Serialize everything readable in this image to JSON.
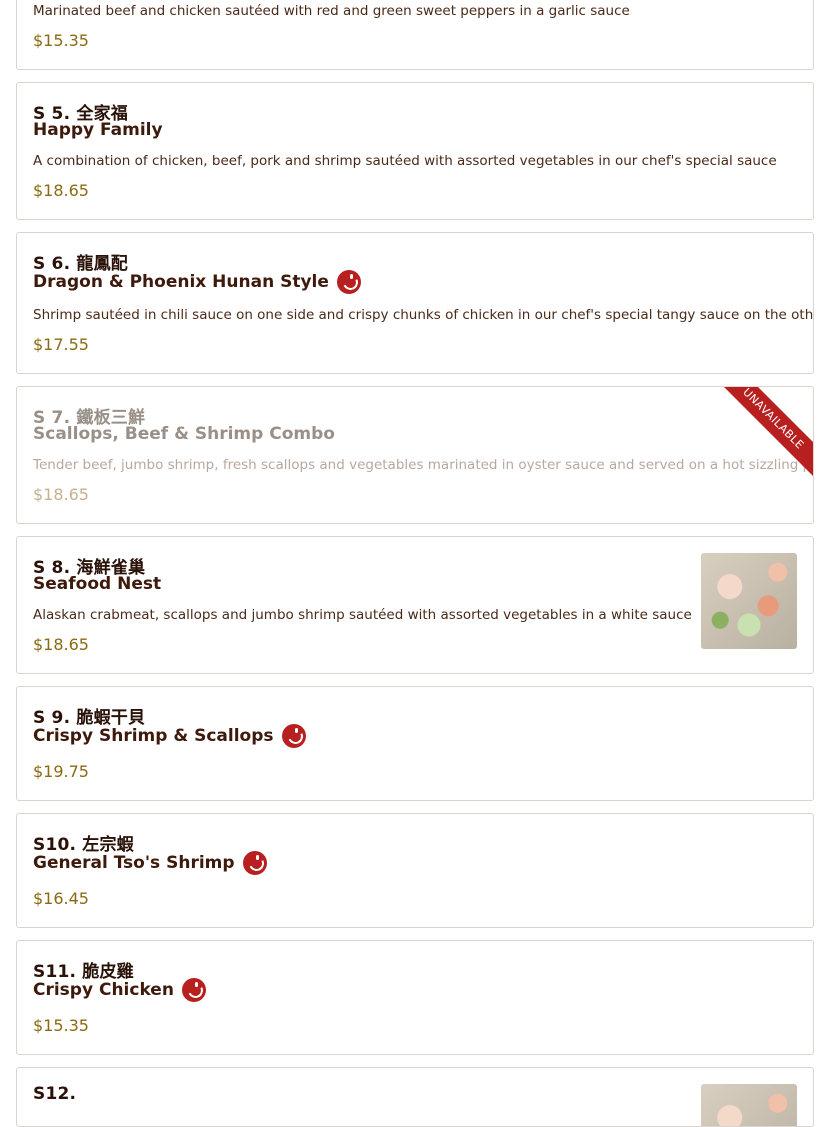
{
  "items": [
    {
      "code": "",
      "name": "",
      "desc": "Marinated beef and chicken sautéed with red and green sweet peppers in a garlic sauce",
      "price": "$15.35"
    },
    {
      "code": "S 5. 全家福",
      "name": "Happy Family",
      "desc": "A combination of chicken, beef, pork and shrimp sautéed with assorted vegetables in our chef's special sauce",
      "price": "$18.65"
    },
    {
      "code": "S 6. 龍鳳配",
      "name": "Dragon & Phoenix Hunan Style",
      "spicy": true,
      "desc": "Shrimp sautéed in chili sauce on one side and crispy chunks of chicken in our chef's special tangy sauce on the other side",
      "price": "$17.55"
    },
    {
      "code": "S 7. 鐵板三鮮",
      "name": "Scallops, Beef & Shrimp Combo",
      "desc": "Tender beef, jumbo shrimp, fresh scallops and vegetables marinated in oyster sauce and served on a hot sizzling platter",
      "price": "$18.65",
      "unavailable_label": "UNAVAILABLE"
    },
    {
      "code": "S 8. 海鮮雀巢",
      "name": "Seafood Nest",
      "desc": "Alaskan crabmeat, scallops and jumbo shrimp sautéed with assorted vegetables in a white sauce",
      "price": "$18.65",
      "has_image": true
    },
    {
      "code": "S 9. 脆蝦干貝",
      "name": "Crispy Shrimp & Scallops",
      "spicy": true,
      "price": "$19.75"
    },
    {
      "code": "S10. 左宗蝦",
      "name": "General Tso's Shrimp",
      "spicy": true,
      "price": "$16.45"
    },
    {
      "code": "S11. 脆皮雞",
      "name": "Crispy Chicken",
      "spicy": true,
      "price": "$15.35"
    },
    {
      "code": "S12.",
      "name": ""
    }
  ],
  "colors": {
    "spicy_badge": "#b82020",
    "price": "#8a6a12",
    "border": "#d9d4cf"
  },
  "icons": {
    "spicy": "chili-pepper-icon"
  }
}
